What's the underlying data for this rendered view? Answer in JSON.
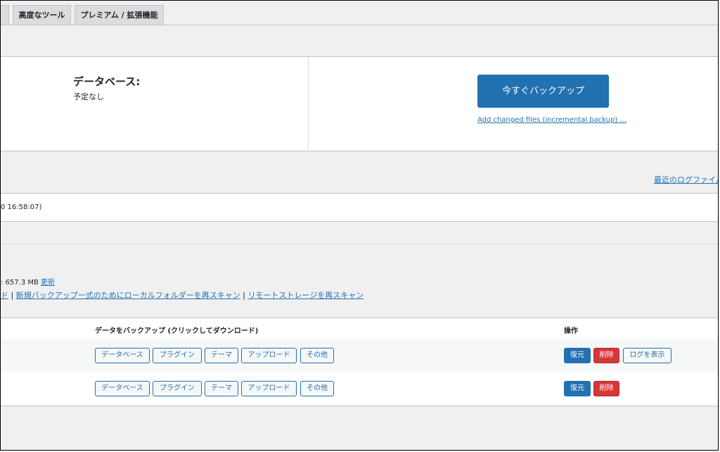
{
  "tabs": [
    {
      "label": "高度なツール"
    },
    {
      "label": "プレミアム / 拡張機能"
    }
  ],
  "schedule": {
    "heading": "データベース:",
    "status": "予定なし"
  },
  "backup_now": {
    "label": "今すぐバックアップ",
    "incremental_link": "Add changed files (incremental backup) ..."
  },
  "log": {
    "recent_log_link": "最近のログファイル",
    "last_log_text": "0 16:58:07)"
  },
  "storage": {
    "usage_prefix": ": 657.3 MB",
    "refresh_link": "更新",
    "rescan_prefix": "ド",
    "rescan_local_link": "新規バックアップ一式のためにローカルフォルダーを再スキャン",
    "separator": "|",
    "rescan_remote_link": "リモートストレージを再スキャン"
  },
  "table": {
    "header_data": "データをバックアップ (クリックしてダウンロード)",
    "header_actions": "操作",
    "rows": [
      {
        "components": [
          "データベース",
          "プラグイン",
          "テーマ",
          "アップロード",
          "その他"
        ],
        "restore": "復元",
        "delete": "削除",
        "view_log": "ログを表示"
      },
      {
        "components": [
          "データベース",
          "プラグイン",
          "テーマ",
          "アップロード",
          "その他"
        ],
        "restore": "復元",
        "delete": "削除"
      }
    ]
  },
  "colors": {
    "accent": "#2271b1",
    "danger": "#d63638",
    "background": "#f0f0f1"
  }
}
